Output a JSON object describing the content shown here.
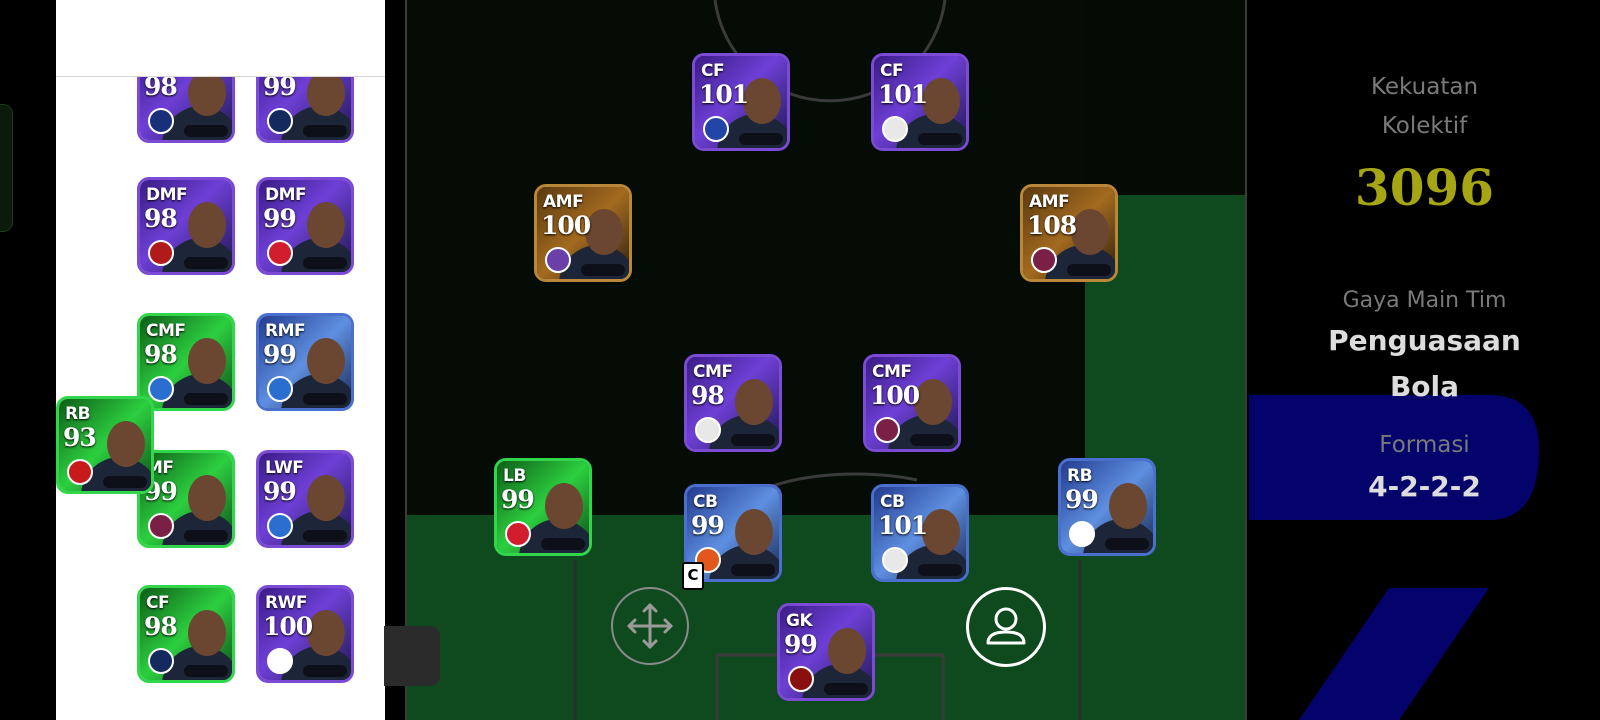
{
  "team_stats": {
    "strength_label_line1": "Kekuatan",
    "strength_label_line2": "Kolektif",
    "strength_value": "3096",
    "playstyle_label": "Gaya Main Tim",
    "playstyle_value_line1": "Penguasaan",
    "playstyle_value_line2": "Bola",
    "formation_label": "Formasi",
    "formation_value": "4-2-2-2"
  },
  "captain_marker": "C",
  "reserves": [
    {
      "position": "",
      "rating": "98",
      "style": "purple",
      "badge": "inter"
    },
    {
      "position": "",
      "rating": "99",
      "style": "purple",
      "badge": "psg"
    },
    {
      "position": "DMF",
      "rating": "98",
      "style": "purple",
      "badge": "milan"
    },
    {
      "position": "DMF",
      "rating": "99",
      "style": "purple",
      "badge": "bayern"
    },
    {
      "position": "CMF",
      "rating": "98",
      "style": "green",
      "badge": "club-blue"
    },
    {
      "position": "RMF",
      "rating": "99",
      "style": "blue",
      "badge": "club-blue"
    },
    {
      "position": "MF",
      "rating": "99",
      "style": "green",
      "badge": "barcelona"
    },
    {
      "position": "LWF",
      "rating": "99",
      "style": "purple",
      "badge": "club-blue"
    },
    {
      "position": "CF",
      "rating": "98",
      "style": "green",
      "badge": "psg"
    },
    {
      "position": "RWF",
      "rating": "100",
      "style": "purple",
      "badge": "england"
    }
  ],
  "dragged_card": {
    "position": "RB",
    "rating": "93",
    "style": "green",
    "badge": "arsenal"
  },
  "lineup": [
    {
      "position": "CF",
      "rating": "101",
      "style": "purple",
      "badge": "france"
    },
    {
      "position": "CF",
      "rating": "101",
      "style": "purple",
      "badge": "club-white"
    },
    {
      "position": "AMF",
      "rating": "100",
      "style": "gold",
      "badge": "club-purple"
    },
    {
      "position": "AMF",
      "rating": "108",
      "style": "gold",
      "badge": "barcelona"
    },
    {
      "position": "CMF",
      "rating": "98",
      "style": "purple",
      "badge": "club-white"
    },
    {
      "position": "CMF",
      "rating": "100",
      "style": "purple",
      "badge": "barcelona"
    },
    {
      "position": "LB",
      "rating": "99",
      "style": "green",
      "badge": "bayern"
    },
    {
      "position": "CB",
      "rating": "99",
      "style": "blue",
      "badge": "netherlands"
    },
    {
      "position": "CB",
      "rating": "101",
      "style": "blue",
      "badge": "club-white"
    },
    {
      "position": "RB",
      "rating": "99",
      "style": "blue",
      "badge": "england"
    },
    {
      "position": "GK",
      "rating": "99",
      "style": "purple",
      "badge": "club-red"
    }
  ],
  "icons": {
    "move": "move-arrows-icon",
    "player": "player-profile-icon"
  },
  "colors": {
    "strength": "#a6a614",
    "pitch_green": "#0f4a1f",
    "card_purple": "#7b4bd6",
    "card_gold": "#b9873a",
    "card_green": "#31d64a"
  }
}
